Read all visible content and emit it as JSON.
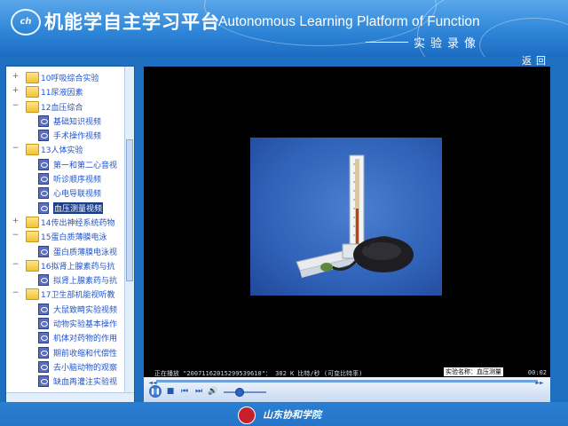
{
  "header": {
    "logo_text": "ch",
    "title_cn": "机能学自主学习平台",
    "title_en": "Autonomous Learning Platform of Function",
    "subtitle": "实验录像"
  },
  "nav": {
    "back_label": "返回"
  },
  "tree": {
    "items": [
      {
        "label": "10呼吸综合实验",
        "type": "folder",
        "level": 0,
        "expander": "+"
      },
      {
        "label": "11尿液因素",
        "type": "folder",
        "level": 0,
        "expander": "+"
      },
      {
        "label": "12血压综合",
        "type": "folder",
        "level": 0,
        "expander": "−"
      },
      {
        "label": "基础知识视频",
        "type": "video",
        "level": 1
      },
      {
        "label": "手术操作视频",
        "type": "video",
        "level": 1
      },
      {
        "label": "13人体实验",
        "type": "folder",
        "level": 0,
        "expander": "−"
      },
      {
        "label": "第一和第二心音视",
        "type": "video",
        "level": 1
      },
      {
        "label": "听诊顺序视频",
        "type": "video",
        "level": 1
      },
      {
        "label": "心电导联视频",
        "type": "video",
        "level": 1
      },
      {
        "label": "血压测量视频",
        "type": "video",
        "level": 1,
        "selected": true
      },
      {
        "label": "14传出神经系统药物",
        "type": "folder",
        "level": 0,
        "expander": "+"
      },
      {
        "label": "15蛋白质薄膜电泳",
        "type": "folder",
        "level": 0,
        "expander": "−"
      },
      {
        "label": "蛋白质薄膜电泳视",
        "type": "video",
        "level": 1
      },
      {
        "label": "16拟肾上腺素药与抗",
        "type": "folder",
        "level": 0,
        "expander": "−"
      },
      {
        "label": "拟肾上腺素药与抗",
        "type": "video",
        "level": 1
      },
      {
        "label": "17卫生部机能视听教",
        "type": "folder",
        "level": 0,
        "expander": "−"
      },
      {
        "label": "大鼠致畸实验视频",
        "type": "video",
        "level": 1
      },
      {
        "label": "动物实验基本操作",
        "type": "video",
        "level": 1
      },
      {
        "label": "机体对药物的作用",
        "type": "video",
        "level": 1
      },
      {
        "label": "期前收缩和代偿性",
        "type": "video",
        "level": 1
      },
      {
        "label": "去小脑动物的观察",
        "type": "video",
        "level": 1
      },
      {
        "label": "缺血再灌注实验视",
        "type": "video",
        "level": 1
      }
    ]
  },
  "player": {
    "status_text": "正在播放 \"20071162015299539610\"： 302 K 比特/秒 (可变比特率)",
    "clip_name": "实验名称：血压测量",
    "time": "00:02",
    "progress": 0.0,
    "volume": 0.35
  },
  "footer": {
    "institution": "山东协和学院"
  },
  "colors": {
    "header_blue": "#2f86d8",
    "selected_bg": "#173e8c",
    "player_bg": "#000000"
  }
}
